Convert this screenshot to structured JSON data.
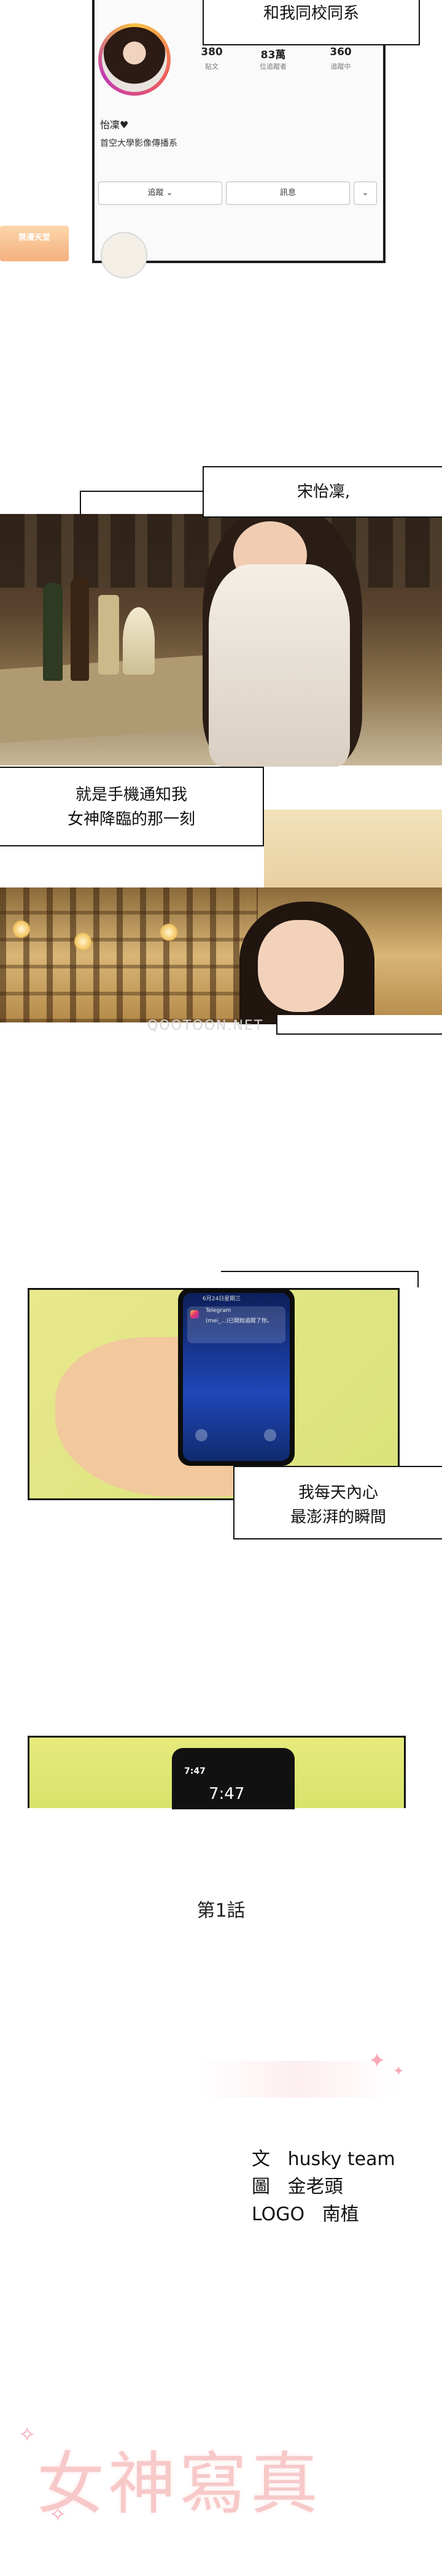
{
  "profile": {
    "stats": [
      {
        "num": "380",
        "label": "貼文"
      },
      {
        "num": "83萬",
        "label": "位追蹤者"
      },
      {
        "num": "360",
        "label": "追蹤中"
      }
    ],
    "name": "怡凜♥",
    "bio": "首空大學影像傳播系",
    "follow_label": "追蹤",
    "message_label": "訊息"
  },
  "watermark": "禁漫天堂",
  "bubbles": {
    "b1": "和我同校同系",
    "b2": "宋怡凜,",
    "b3_line1": "就是手機通知我",
    "b3_line2": "女神降臨的那一刻",
    "b4_line1": "我每天內心",
    "b4_line2": "最澎湃的瞬間"
  },
  "site_watermark": "QOOTOON.NET",
  "notification": {
    "date": "6月24日星期三",
    "app": "Telegram",
    "text": "(mei_...)已開始追蹤了你。"
  },
  "lockscreen": {
    "small_time": "7:47",
    "big_time": "7:47"
  },
  "chapter": "第1話",
  "credits": {
    "writer_label": "文",
    "writer": "husky team",
    "artist_label": "圖",
    "artist": "金老頭",
    "logo_label": "LOGO",
    "logo": "南植"
  },
  "title": "女神寫真"
}
